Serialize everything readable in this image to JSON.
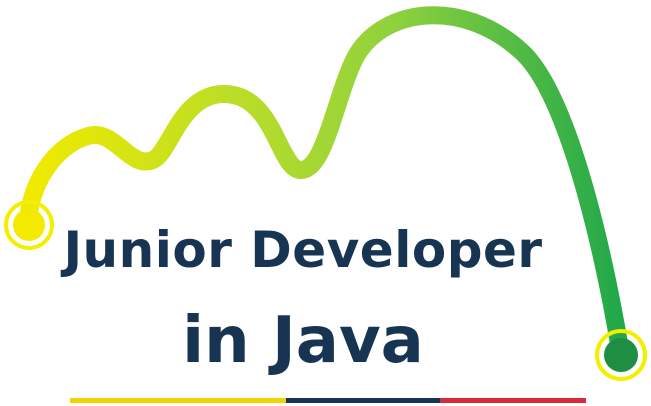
{
  "logo": {
    "title_line_1": "Junior Developer",
    "title_line_2": "in Java"
  },
  "colors": {
    "curve_start": "#f1ea00",
    "curve_mid": "#8ed13d",
    "curve_end": "#20a84a",
    "start_dot": "#f3ea00",
    "end_dot": "#1d8e42",
    "ring": "#f4ee00",
    "text": "#173553",
    "stripe_yellow": "#f4d400",
    "stripe_navy": "#173553",
    "stripe_red": "#d62b3a"
  }
}
